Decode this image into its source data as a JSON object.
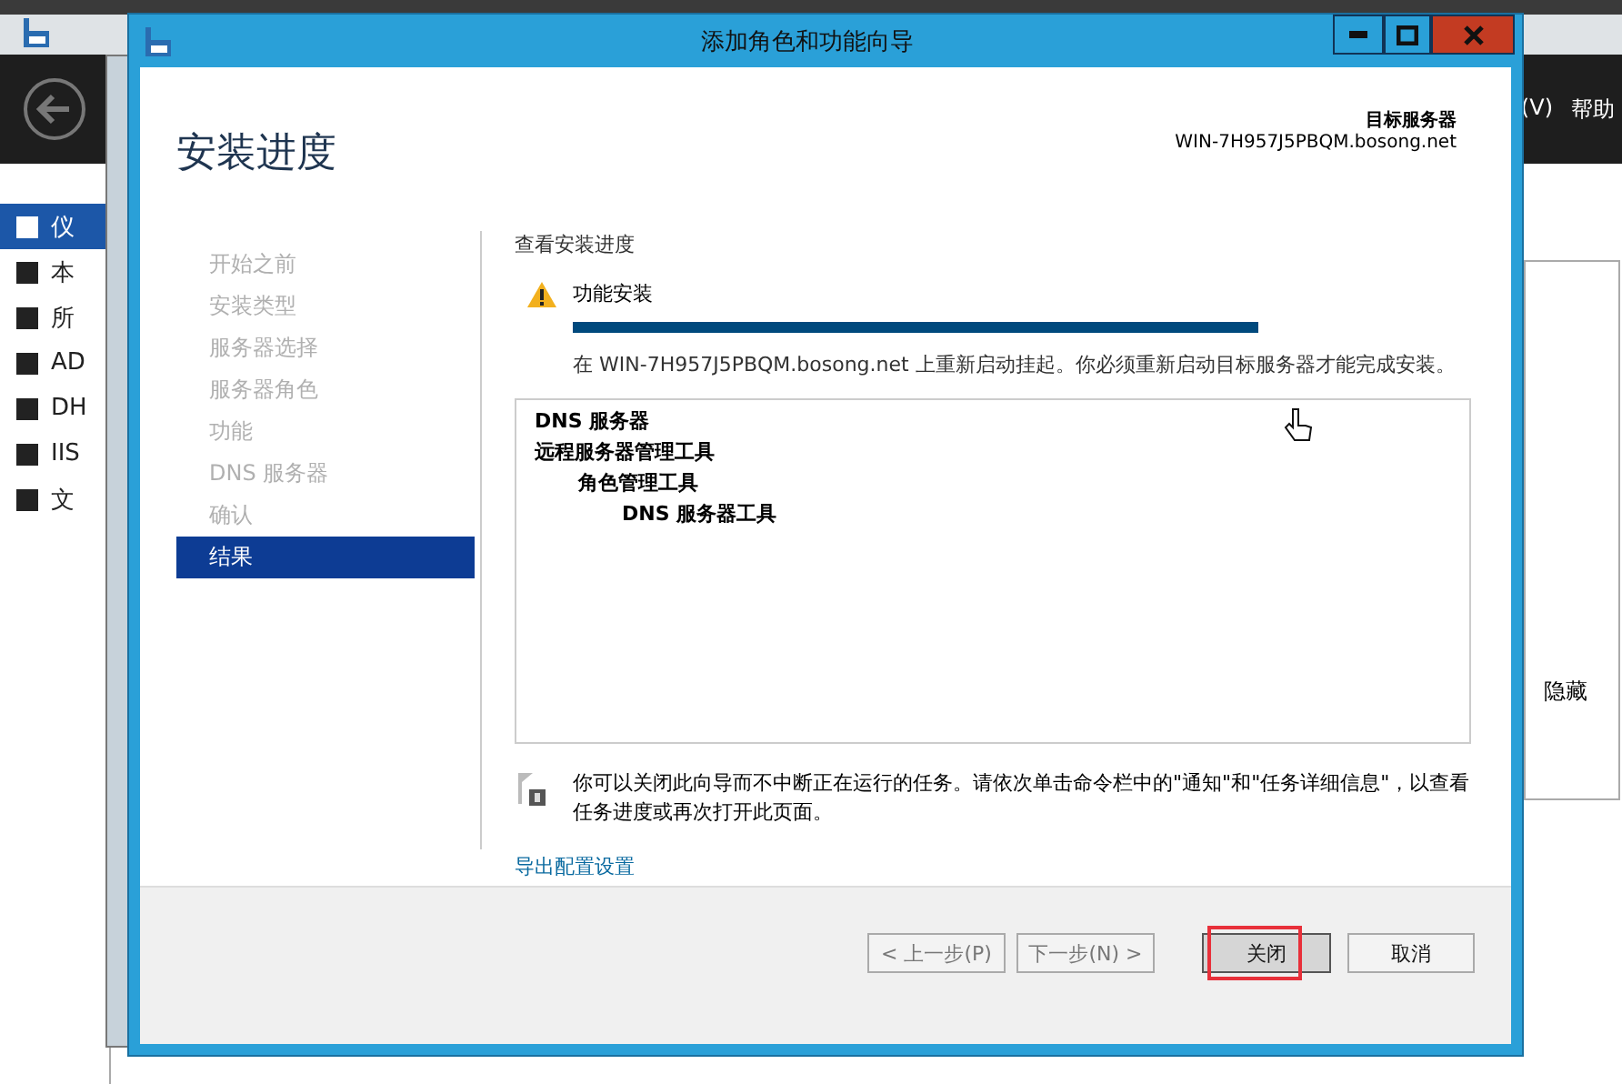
{
  "background_window": {
    "sidebar": {
      "items": [
        {
          "label": "仪",
          "selected": true
        },
        {
          "label": "本",
          "selected": false
        },
        {
          "label": "所",
          "selected": false
        },
        {
          "label": "AD",
          "selected": false
        },
        {
          "label": "DH",
          "selected": false
        },
        {
          "label": "IIS",
          "selected": false
        },
        {
          "label": "文",
          "selected": false
        }
      ]
    },
    "menu": [
      "(V)",
      "帮助"
    ],
    "side_panel_label": "隐藏"
  },
  "dialog": {
    "title": "添加角色和功能向导",
    "page_title": "安装进度",
    "target_label": "目标服务器",
    "target_server": "WIN-7H957J5PBQM.bosong.net",
    "steps": [
      {
        "label": "开始之前",
        "selected": false
      },
      {
        "label": "安装类型",
        "selected": false
      },
      {
        "label": "服务器选择",
        "selected": false
      },
      {
        "label": "服务器角色",
        "selected": false
      },
      {
        "label": "功能",
        "selected": false
      },
      {
        "label": "DNS 服务器",
        "selected": false
      },
      {
        "label": "确认",
        "selected": false
      },
      {
        "label": "结果",
        "selected": true
      }
    ],
    "section_label": "查看安装进度",
    "status": {
      "title": "功能安装",
      "level": 1,
      "message": "在 WIN-7H957J5PBQM.bosong.net 上重新启动挂起。你必须重新启动目标服务器才能完成安装。"
    },
    "features": [
      {
        "label": "DNS 服务器"
      },
      {
        "label": "远程服务器管理工具",
        "children": [
          {
            "label": "角色管理工具",
            "children": [
              {
                "label": "DNS 服务器工具"
              }
            ]
          }
        ]
      }
    ],
    "note": "你可以关闭此向导而不中断正在运行的任务。请依次单击命令栏中的\"通知\"和\"任务详细信息\"，以查看任务进度或再次打开此页面。",
    "export_link": "导出配置设置",
    "buttons": [
      {
        "label": "< 上一步(P)",
        "disabled": true,
        "highlighted": false
      },
      {
        "label": "下一步(N) >",
        "disabled": true,
        "highlighted": false
      },
      {
        "label": "关闭",
        "disabled": false,
        "highlighted": true
      },
      {
        "label": "取消",
        "disabled": false,
        "highlighted": false
      }
    ]
  }
}
